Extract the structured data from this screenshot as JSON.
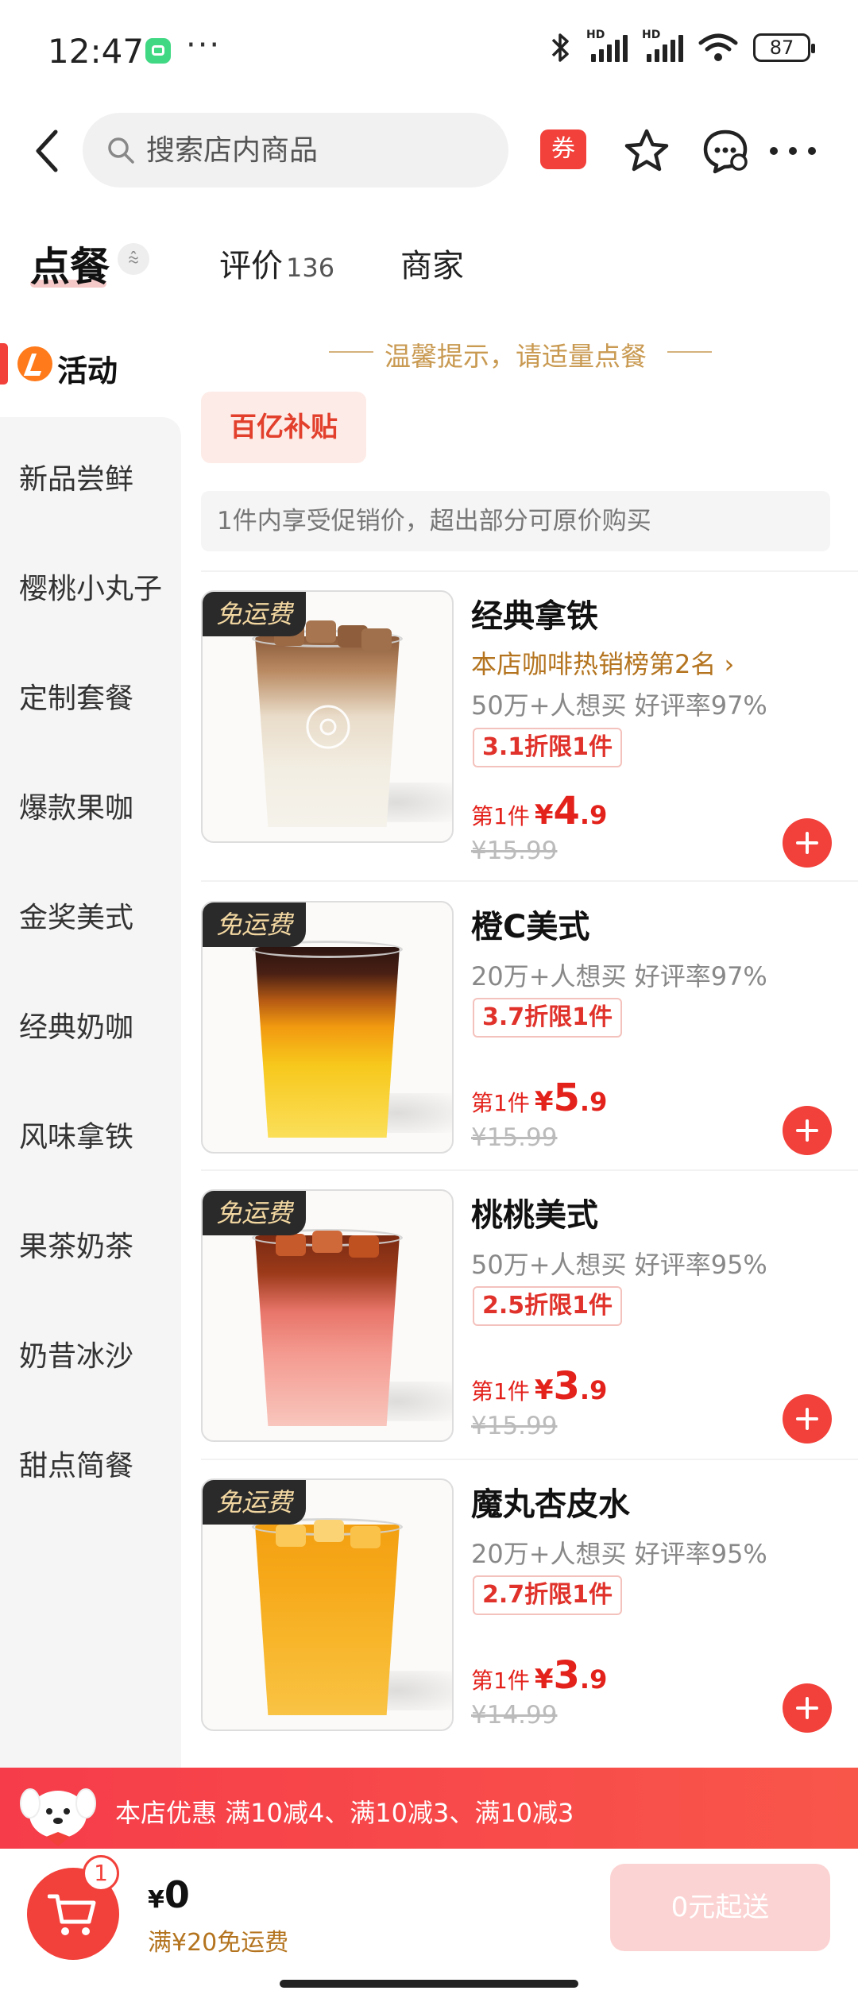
{
  "status": {
    "time": "12:47",
    "dots": "···",
    "net1": "HD",
    "net2": "HD",
    "battery": "87"
  },
  "header": {
    "search_placeholder": "搜索店内商品",
    "coupon_label": "券"
  },
  "tabs": {
    "order": "点餐",
    "reviews": "评价",
    "reviews_count": "136",
    "merchant": "商家",
    "collapse_glyph": "⩯"
  },
  "sidebar": {
    "active": "活动",
    "items": [
      "新品尝鲜",
      "樱桃小丸子",
      "定制套餐",
      "爆款果咖",
      "金奖美式",
      "经典奶咖",
      "风味拿铁",
      "果茶奶茶",
      "奶昔冰沙",
      "甜点简餐"
    ]
  },
  "main": {
    "tip": "温馨提示，请适量点餐",
    "subsidy": "百亿补贴",
    "notice": "1件内享受促销价，超出部分可原价购买",
    "free_tag": "免运费",
    "products": [
      {
        "name": "经典拿铁",
        "rank": "本店咖啡热销榜第2名 ›",
        "stats": "50万+人想买 好评率97%",
        "discount": "3.1折限1件",
        "price_prefix": "第1件",
        "yen": "¥",
        "price_int": "4",
        "price_dec": ".9",
        "orig": "¥15.99"
      },
      {
        "name": "橙C美式",
        "rank": "",
        "stats": "20万+人想买 好评率97%",
        "discount": "3.7折限1件",
        "price_prefix": "第1件",
        "yen": "¥",
        "price_int": "5",
        "price_dec": ".9",
        "orig": "¥15.99"
      },
      {
        "name": "桃桃美式",
        "rank": "",
        "stats": "50万+人想买 好评率95%",
        "discount": "2.5折限1件",
        "price_prefix": "第1件",
        "yen": "¥",
        "price_int": "3",
        "price_dec": ".9",
        "orig": "¥15.99"
      },
      {
        "name": "魔丸杏皮水",
        "rank": "",
        "stats": "20万+人想买 好评率95%",
        "discount": "2.7折限1件",
        "price_prefix": "第1件",
        "yen": "¥",
        "price_int": "3",
        "price_dec": ".9",
        "orig": "¥14.99"
      }
    ]
  },
  "promo": {
    "text": "本店优惠  满10减4、满10减3、满10减3"
  },
  "cart": {
    "badge": "1",
    "yen": "¥",
    "total": "0",
    "free_shipping": "满¥20免运费",
    "submit": "0元起送"
  },
  "colors": {
    "accent": "#f2403a",
    "gold": "#b4741f",
    "tip": "#c99a52"
  }
}
